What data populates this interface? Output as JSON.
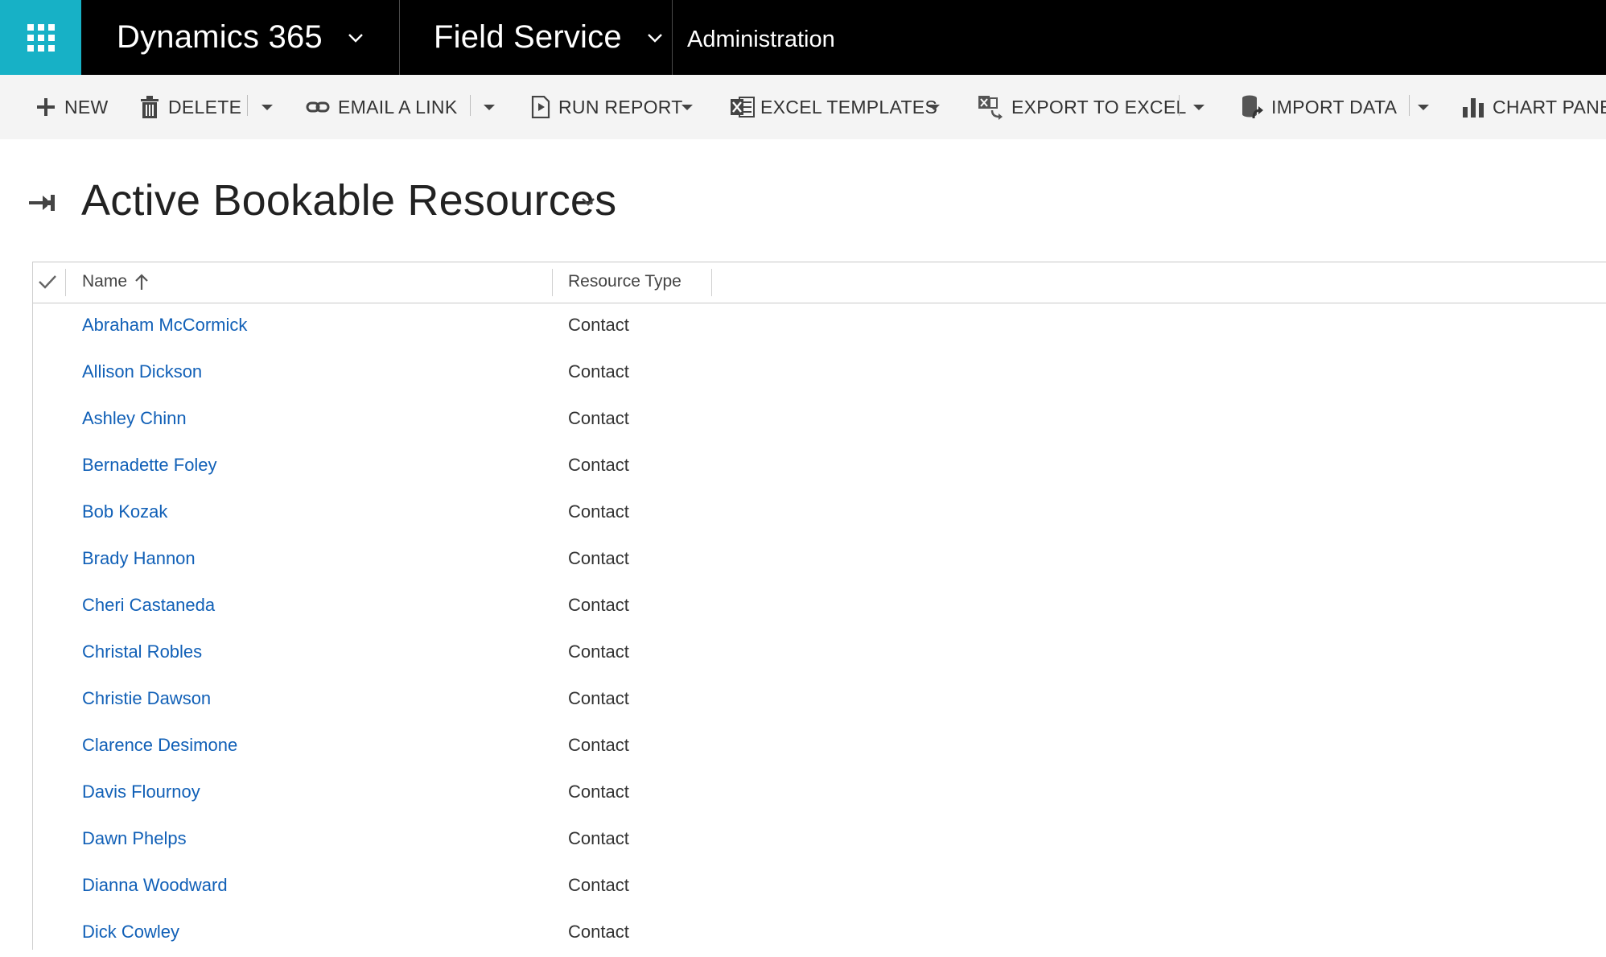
{
  "nav": {
    "app_name": "Dynamics 365",
    "area_name": "Field Service",
    "section_name": "Administration"
  },
  "commands": {
    "new": "NEW",
    "delete": "DELETE",
    "email_link": "EMAIL A LINK",
    "run_report": "RUN REPORT",
    "excel_templates": "EXCEL TEMPLATES",
    "export_excel": "EXPORT TO EXCEL",
    "import_data": "IMPORT DATA",
    "chart_pane": "CHART PANE"
  },
  "view": {
    "title": "Active Bookable Resources"
  },
  "grid": {
    "columns": [
      "Name",
      "Resource Type"
    ],
    "sort": "ascending",
    "rows": [
      {
        "name": "Abraham McCormick",
        "type": "Contact"
      },
      {
        "name": "Allison Dickson",
        "type": "Contact"
      },
      {
        "name": "Ashley Chinn",
        "type": "Contact"
      },
      {
        "name": "Bernadette Foley",
        "type": "Contact"
      },
      {
        "name": "Bob Kozak",
        "type": "Contact"
      },
      {
        "name": "Brady Hannon",
        "type": "Contact"
      },
      {
        "name": "Cheri Castaneda",
        "type": "Contact"
      },
      {
        "name": "Christal Robles",
        "type": "Contact"
      },
      {
        "name": "Christie Dawson",
        "type": "Contact"
      },
      {
        "name": "Clarence Desimone",
        "type": "Contact"
      },
      {
        "name": "Davis Flournoy",
        "type": "Contact"
      },
      {
        "name": "Dawn Phelps",
        "type": "Contact"
      },
      {
        "name": "Dianna Woodward",
        "type": "Contact"
      },
      {
        "name": "Dick Cowley",
        "type": "Contact"
      }
    ]
  },
  "colors": {
    "waffle_bg": "#17b1c6",
    "nav_bg": "#000000",
    "command_bar_bg": "#f4f4f4",
    "link": "#1160b7"
  }
}
